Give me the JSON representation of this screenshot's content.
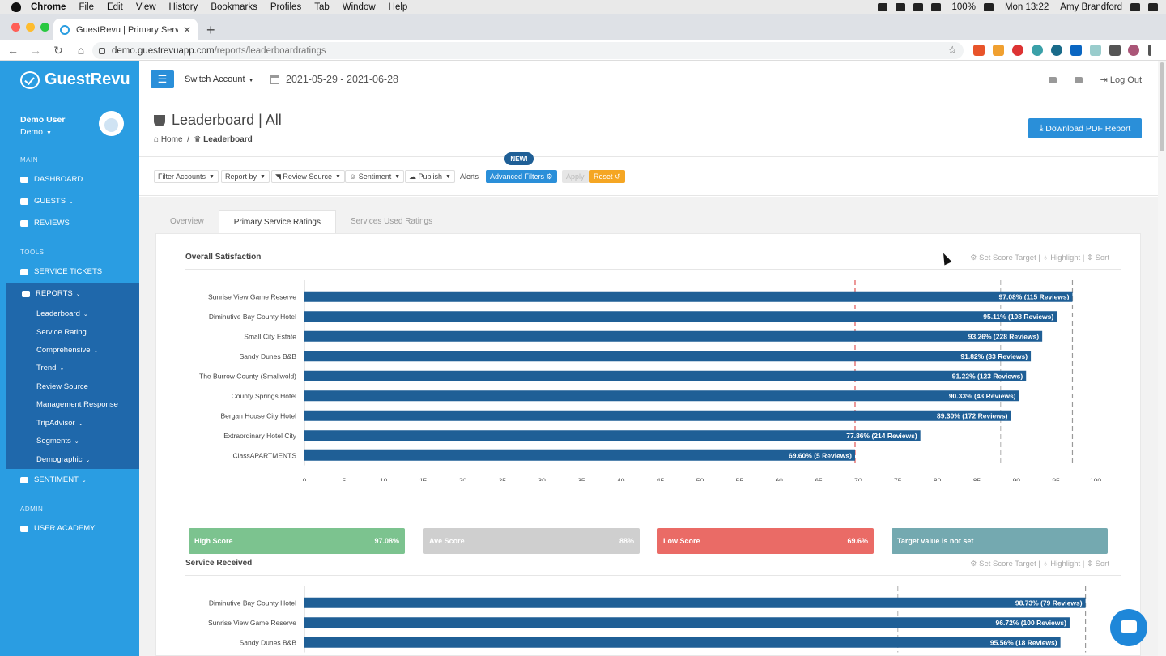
{
  "macmenu": {
    "app": "Chrome",
    "items": [
      "File",
      "Edit",
      "View",
      "History",
      "Bookmarks",
      "Profiles",
      "Tab",
      "Window",
      "Help"
    ],
    "battery": "100%",
    "clock": "Mon 13:22",
    "user": "Amy Brandford"
  },
  "browser": {
    "tab_title": "GuestRevu | Primary Service R",
    "url_host": "demo.guestrevuapp.com",
    "url_path": "/reports/leaderboardratings"
  },
  "sidebar": {
    "logo": "GuestRevu",
    "user_name": "Demo User",
    "account": "Demo",
    "sections": {
      "main": "MAIN",
      "tools": "TOOLS",
      "admin": "ADMIN"
    },
    "main_items": [
      "DASHBOARD",
      "GUESTS",
      "REVIEWS"
    ],
    "tools_items": [
      "SERVICE TICKETS"
    ],
    "reports_label": "REPORTS",
    "report_sub": [
      "Leaderboard",
      "Service Rating",
      "Comprehensive",
      "Trend",
      "Review Source",
      "Management Response",
      "TripAdvisor",
      "Segments",
      "Demographic"
    ],
    "sentiment": "SENTIMENT",
    "admin_items": [
      "USER ACADEMY"
    ]
  },
  "topbar": {
    "switch_account": "Switch Account",
    "date_range": "2021-05-29 - 2021-06-28",
    "logout": "Log Out"
  },
  "page": {
    "title": "Leaderboard | All",
    "breadcrumb_home": "Home",
    "breadcrumb_current": "Leaderboard",
    "download_btn": "Download PDF Report"
  },
  "filters": {
    "filter_accounts": "Filter Accounts",
    "report_by": "Report by",
    "review_source": "Review Source",
    "sentiment": "Sentiment",
    "publish": "Publish",
    "alerts": "Alerts",
    "advanced": "Advanced Filters",
    "new_badge": "NEW!",
    "apply": "Apply",
    "reset": "Reset"
  },
  "tabs": [
    "Overview",
    "Primary Service Ratings",
    "Services Used Ratings"
  ],
  "chart_links": {
    "set_target": "Set Score Target",
    "highlight": "Highlight",
    "sort": "Sort"
  },
  "scores": {
    "high_label": "High Score",
    "high_value": "97.08%",
    "ave_label": "Ave Score",
    "ave_value": "88%",
    "low_label": "Low Score",
    "low_value": "69.6%",
    "target_label": "Target value is not set",
    "colors": {
      "high": "#7cc38f",
      "ave": "#cfcfcf",
      "low": "#ea6b66",
      "target": "#74a9b0"
    }
  },
  "chart_data": [
    {
      "type": "bar",
      "orientation": "horizontal",
      "title": "Overall Satisfaction",
      "categories": [
        "Sunrise View Game Reserve",
        "Diminutive Bay County Hotel",
        "Small City Estate",
        "Sandy Dunes B&B",
        "The Burrow County (Smallwold)",
        "County Springs Hotel",
        "Bergan House City Hotel",
        "Extraordinary Hotel City",
        "ClassAPARTMENTS"
      ],
      "values": [
        97.08,
        95.11,
        93.26,
        91.82,
        91.22,
        90.33,
        89.3,
        77.86,
        69.6
      ],
      "data_labels": [
        "97.08% (115 Reviews)",
        "95.11% (108 Reviews)",
        "93.26% (228 Reviews)",
        "91.82% (33 Reviews)",
        "91.22% (123 Reviews)",
        "90.33% (43 Reviews)",
        "89.30% (172 Reviews)",
        "77.86% (214 Reviews)",
        "69.60% (5 Reviews)"
      ],
      "xlim": [
        0,
        100
      ],
      "xticks": [
        0,
        5,
        10,
        15,
        20,
        25,
        30,
        35,
        40,
        45,
        50,
        55,
        60,
        65,
        70,
        75,
        80,
        85,
        90,
        95,
        100
      ],
      "reference_lines": {
        "low": 69.6,
        "average": 88,
        "high": 97.08
      },
      "bar_color": "#1f5f96"
    },
    {
      "type": "bar",
      "orientation": "horizontal",
      "title": "Service Received",
      "categories": [
        "Diminutive Bay County Hotel",
        "Sunrise View Game Reserve",
        "Sandy Dunes B&B"
      ],
      "values": [
        98.73,
        96.72,
        95.56
      ],
      "data_labels": [
        "98.73% (79 Reviews)",
        "96.72% (100 Reviews)",
        "95.56% (18 Reviews)"
      ],
      "xlim": [
        0,
        100
      ],
      "reference_lines": {
        "average": 75,
        "high": 98.73
      },
      "bar_color": "#1f5f96"
    }
  ]
}
